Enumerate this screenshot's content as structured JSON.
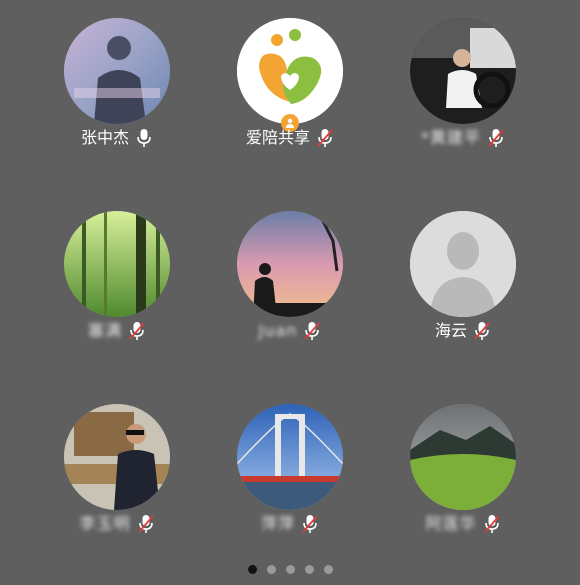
{
  "participants": [
    {
      "name": "张中杰",
      "mic": "on",
      "avatar": "person-portrait-avatar"
    },
    {
      "name": "爱陪共享",
      "mic": "off",
      "avatar": "heart-logo-avatar",
      "host_badge": true
    },
    {
      "name": "*黄建平",
      "mic": "off",
      "avatar": "man-driving-car-avatar",
      "blurred": true
    },
    {
      "name": "塞满",
      "mic": "off",
      "avatar": "forest-avatar",
      "blurred": true
    },
    {
      "name": "Juan",
      "mic": "off",
      "avatar": "sunset-silhouette-avatar",
      "blurred": true
    },
    {
      "name": "海云",
      "mic": "off",
      "avatar": "default-person-avatar"
    },
    {
      "name": "李玉明",
      "mic": "off",
      "avatar": "man-with-sunglasses-avatar",
      "blurred": true
    },
    {
      "name": "萍萍",
      "mic": "off",
      "avatar": "bridge-avatar",
      "blurred": true
    },
    {
      "name": "阿莲华",
      "mic": "off",
      "avatar": "green-mountain-avatar",
      "blurred": true
    }
  ],
  "pagination": {
    "total": 5,
    "current": 1
  },
  "colors": {
    "background": "#5f5f5f",
    "mic_muted_slash": "#e23b3b",
    "host_badge": "#f3a433"
  }
}
